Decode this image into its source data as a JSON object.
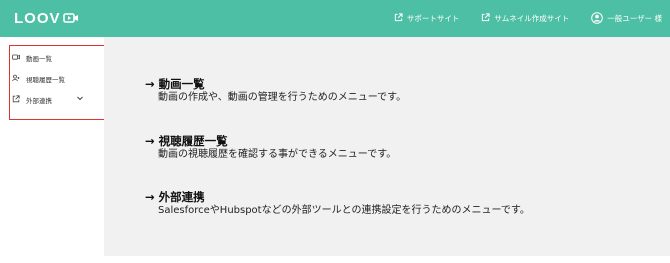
{
  "header": {
    "logo": "LOOV",
    "links": [
      {
        "label": "サポートサイト",
        "icon": "external-link-icon"
      },
      {
        "label": "サムネイル作成サイト",
        "icon": "external-link-icon"
      }
    ],
    "user": {
      "label": "一般ユーザー 様",
      "icon": "user-circle-icon"
    },
    "bg_color": "#4dbfa4"
  },
  "sidebar": {
    "items": [
      {
        "label": "動画一覧",
        "icon": "video-icon"
      },
      {
        "label": "視聴履歴一覧",
        "icon": "user-add-icon"
      },
      {
        "label": "外部連携",
        "icon": "external-link-icon",
        "has_submenu": true
      }
    ],
    "highlight_color": "#e0332b"
  },
  "main": {
    "sections": [
      {
        "title": "→ 動画一覧",
        "description": "動画の作成や、動画の管理を行うためのメニューです。"
      },
      {
        "title": "→ 視聴履歴一覧",
        "description": "動画の視聴履歴を確認する事ができるメニューです。"
      },
      {
        "title": "→ 外部連携",
        "description": "SalesforceやHubspotなどの外部ツールとの連携設定を行うためのメニューです。"
      }
    ]
  }
}
